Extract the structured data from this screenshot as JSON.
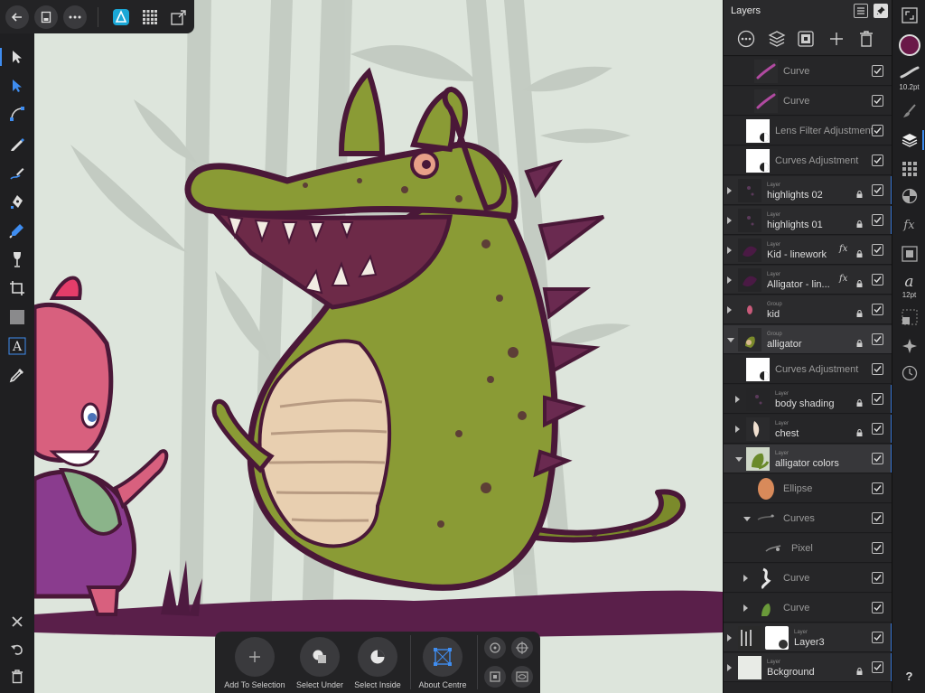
{
  "panel": {
    "title": "Layers",
    "rows": [
      {
        "type": "",
        "name": "Curve",
        "depth": 2,
        "thumb": "curve-purple",
        "dim": true,
        "checked": true
      },
      {
        "type": "",
        "name": "Curve",
        "depth": 2,
        "thumb": "curve-purple",
        "dim": true,
        "checked": true
      },
      {
        "type": "",
        "name": "Lens Filter Adjustment",
        "depth": 1,
        "thumb": "adjust-white",
        "dim": true,
        "checked": true
      },
      {
        "type": "",
        "name": "Curves Adjustment",
        "depth": 1,
        "thumb": "adjust-white",
        "dim": true,
        "checked": true
      },
      {
        "type": "Layer",
        "name": "highlights 02",
        "depth": 0,
        "thumb": "dark",
        "caret": "right",
        "lock": true,
        "checked": true,
        "bluebar": true
      },
      {
        "type": "Layer",
        "name": "highlights 01",
        "depth": 0,
        "thumb": "dark",
        "caret": "right",
        "lock": true,
        "checked": true,
        "bluebar": true
      },
      {
        "type": "Layer",
        "name": "Kid - linework",
        "depth": 0,
        "thumb": "dark-purple",
        "caret": "right",
        "fx": "fx",
        "lock": true,
        "checked": true
      },
      {
        "type": "Layer",
        "name": "Alligator - lin...",
        "depth": 0,
        "thumb": "dark-purple",
        "caret": "right",
        "fx": "fx",
        "lock": true,
        "checked": true
      },
      {
        "type": "Group",
        "name": "kid",
        "depth": 0,
        "thumb": "kid",
        "caret": "right",
        "lock": true,
        "checked": true
      },
      {
        "type": "Group",
        "name": "alligator",
        "depth": 0,
        "thumb": "alligator-small",
        "caret": "down",
        "lock": true,
        "checked": true,
        "selectedGroup": true
      },
      {
        "type": "",
        "name": "Curves Adjustment",
        "depth": 1,
        "thumb": "adjust-white",
        "dim": true,
        "checked": true
      },
      {
        "type": "Layer",
        "name": "body shading",
        "depth": 1,
        "thumb": "dark",
        "caret": "right",
        "lock": true,
        "checked": true,
        "bluebar": true
      },
      {
        "type": "Layer",
        "name": "chest",
        "depth": 1,
        "thumb": "chest",
        "caret": "right",
        "lock": true,
        "checked": true,
        "bluebar": true
      },
      {
        "type": "Layer",
        "name": "alligator colors",
        "depth": 1,
        "thumb": "alligator-green",
        "caret": "down",
        "checked": true,
        "selected": true,
        "bluebar": true
      },
      {
        "type": "",
        "name": "Ellipse",
        "depth": 2,
        "thumb": "ellipse",
        "dim": true,
        "checked": true
      },
      {
        "type": "",
        "name": "Curves",
        "depth": 2,
        "thumb": "curves-dark",
        "caret": "down",
        "dim": true,
        "checked": true
      },
      {
        "type": "",
        "name": "Pixel",
        "depth": 3,
        "thumb": "pixel",
        "dim": true,
        "checked": true
      },
      {
        "type": "",
        "name": "Curve",
        "depth": 2,
        "thumb": "curve-white",
        "caret": "right",
        "dim": true,
        "checked": true
      },
      {
        "type": "",
        "name": "Curve",
        "depth": 2,
        "thumb": "curve-green",
        "caret": "right",
        "dim": true,
        "checked": true
      },
      {
        "type": "Layer",
        "name": "Layer3",
        "depth": 0,
        "thumb": "layer3",
        "caret": "right",
        "checked": true,
        "bluebar": true
      },
      {
        "type": "Layer",
        "name": "Bckground",
        "depth": 0,
        "thumb": "white",
        "caret": "right",
        "lock": true,
        "checked": true,
        "bluebar": true
      }
    ]
  },
  "context_bar": {
    "add_to_selection": "Add To Selection",
    "select_under": "Select Under",
    "select_inside": "Select Inside",
    "about_centre": "About Centre"
  },
  "strip": {
    "brush_size": "10.2pt",
    "font_size": "12pt",
    "help": "?",
    "color": "#6a1848"
  }
}
